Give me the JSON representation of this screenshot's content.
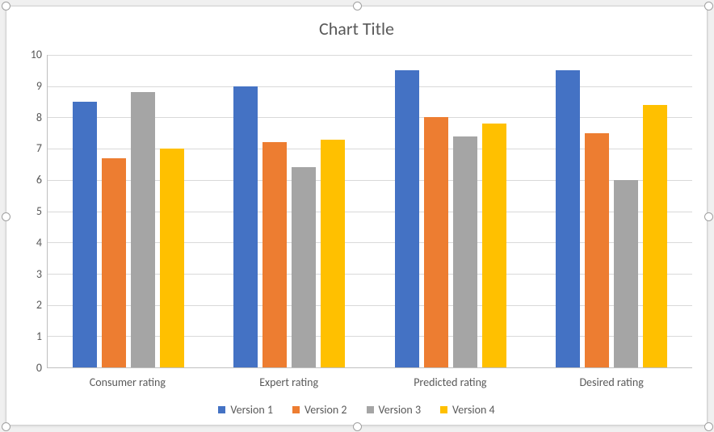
{
  "chart_data": {
    "type": "bar",
    "title": "Chart Title",
    "categories": [
      "Consumer rating",
      "Expert rating",
      "Predicted rating",
      "Desired rating"
    ],
    "series": [
      {
        "name": "Version 1",
        "color": "#4472C4",
        "values": [
          8.5,
          9.0,
          9.5,
          9.5
        ]
      },
      {
        "name": "Version 2",
        "color": "#ED7D31",
        "values": [
          6.7,
          7.2,
          8.0,
          7.5
        ]
      },
      {
        "name": "Version 3",
        "color": "#A5A5A5",
        "values": [
          8.8,
          6.4,
          7.4,
          6.0
        ]
      },
      {
        "name": "Version 4",
        "color": "#FFC000",
        "values": [
          7.0,
          7.3,
          7.8,
          8.4
        ]
      }
    ],
    "xlabel": "",
    "ylabel": "",
    "ylim": [
      0,
      10
    ],
    "y_ticks": [
      0,
      1,
      2,
      3,
      4,
      5,
      6,
      7,
      8,
      9,
      10
    ],
    "grid": true,
    "legend_position": "bottom"
  }
}
